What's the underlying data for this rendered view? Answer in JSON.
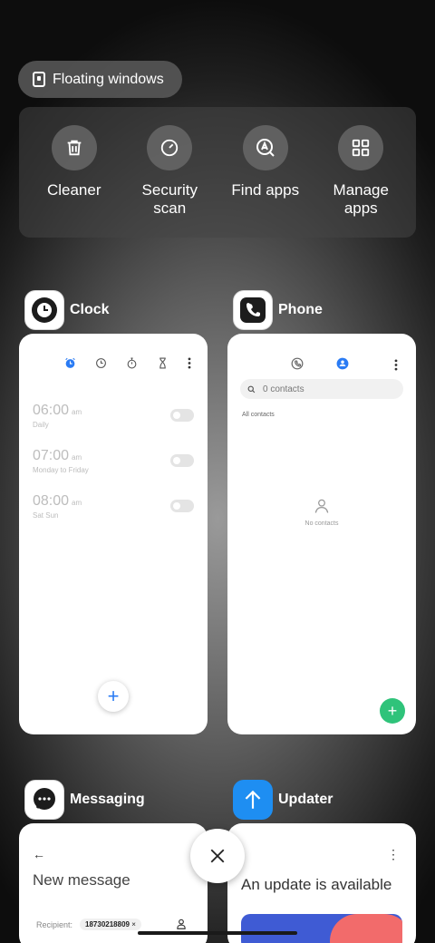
{
  "floating_windows": {
    "label": "Floating windows"
  },
  "quick_actions": [
    {
      "icon": "trash-icon",
      "label": "Cleaner"
    },
    {
      "icon": "security-scan-icon",
      "label": "Security\nscan"
    },
    {
      "icon": "find-apps-icon",
      "label": "Find apps"
    },
    {
      "icon": "grid-icon",
      "label": "Manage\napps"
    }
  ],
  "apps": {
    "clock": {
      "name": "Clock",
      "alarms": [
        {
          "time": "06:00",
          "ampm": "am",
          "repeat": "Daily"
        },
        {
          "time": "07:00",
          "ampm": "am",
          "repeat": "Monday to Friday"
        },
        {
          "time": "08:00",
          "ampm": "am",
          "repeat": "Sat Sun"
        }
      ],
      "add_symbol": "+"
    },
    "phone": {
      "name": "Phone",
      "search_placeholder": "0 contacts",
      "all_contacts": "All contacts",
      "empty_text": "No contacts",
      "add_symbol": "+"
    },
    "messaging": {
      "name": "Messaging",
      "back_symbol": "←",
      "title": "New message",
      "recipient_label": "Recipient:",
      "recipient_chip": "18730218809",
      "chip_close": "×"
    },
    "updater": {
      "name": "Updater",
      "menu_symbol": "⋮",
      "title": "An update is available"
    }
  },
  "colors": {
    "accent_blue": "#2a7bf4",
    "accent_green": "#2fc37a",
    "updater_blue": "#1e8ef2",
    "banner_blue": "#3f5bd4",
    "banner_pink": "#f26b6b"
  }
}
